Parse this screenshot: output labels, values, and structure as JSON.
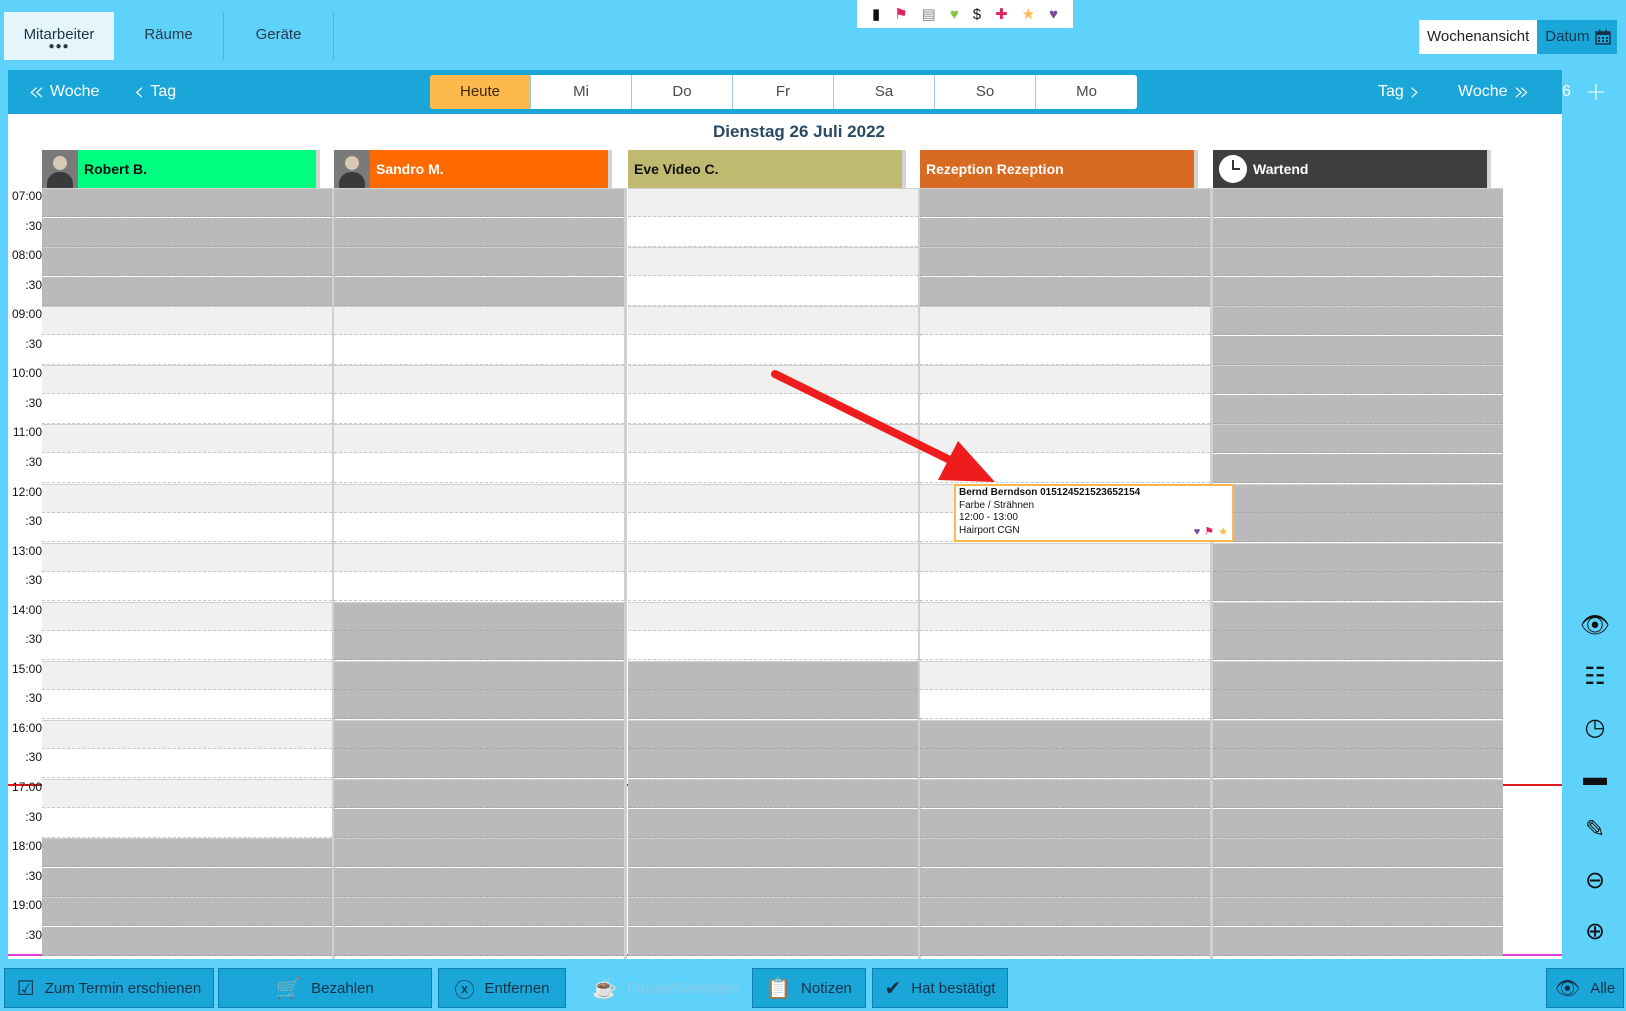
{
  "top_tabs": [
    {
      "label": "Mitarbeiter",
      "active": true
    },
    {
      "label": "Räume",
      "active": false
    },
    {
      "label": "Geräte",
      "active": false
    }
  ],
  "icon_strip": [
    {
      "icon": "phone-icon",
      "glyph": "▮",
      "color": "#111111"
    },
    {
      "icon": "flag-icon",
      "glyph": "⚑",
      "color": "#e0245e"
    },
    {
      "icon": "clipboard-icon",
      "glyph": "▤",
      "color": "#888888"
    },
    {
      "icon": "heart-icon",
      "glyph": "♥",
      "color": "#8ac43f"
    },
    {
      "icon": "dollar-icon",
      "glyph": "$",
      "color": "#111111"
    },
    {
      "icon": "plus-icon",
      "glyph": "✚",
      "color": "#e0245e"
    },
    {
      "icon": "star-icon",
      "glyph": "★",
      "color": "#fdb94c"
    },
    {
      "icon": "broken-heart-icon",
      "glyph": "♥",
      "color": "#7a4a9a"
    }
  ],
  "view_switch": {
    "week_view": "Wochenansicht",
    "date": "Datum"
  },
  "nav": {
    "prev_week": "Woche",
    "prev_day": "Tag",
    "next_day": "Tag",
    "next_week": "Woche",
    "count": "6",
    "days": [
      {
        "label": "Heute",
        "active": true
      },
      {
        "label": "Mi",
        "active": false
      },
      {
        "label": "Do",
        "active": false
      },
      {
        "label": "Fr",
        "active": false
      },
      {
        "label": "Sa",
        "active": false
      },
      {
        "label": "So",
        "active": false
      },
      {
        "label": "Mo",
        "active": false
      }
    ]
  },
  "date_heading": "Dienstag 26 Juli 2022",
  "staff": [
    {
      "name": "Robert B.",
      "color": "#00ff80",
      "avatar": "photo",
      "text_color": "#111111"
    },
    {
      "name": "Sandro M.",
      "color": "#ff6a00",
      "avatar": "photo",
      "text_color": "#ffffff"
    },
    {
      "name": "Eve Video C.",
      "color": "#bfba70",
      "avatar": "none",
      "text_color": "#111111"
    },
    {
      "name": "Rezeption Rezeption",
      "color": "#d86a22",
      "avatar": "none",
      "text_color": "#ffffff"
    },
    {
      "name": "Wartend",
      "color": "#3e3e3e",
      "avatar": "clock",
      "text_color": "#ffffff"
    }
  ],
  "time_labels": [
    "07:00",
    ":30",
    "08:00",
    ":30",
    "09:00",
    ":30",
    "10:00",
    ":30",
    "11:00",
    ":30",
    "12:00",
    ":30",
    "13:00",
    ":30",
    "14:00",
    ":30",
    "15:00",
    ":30",
    "16:00",
    ":30",
    "17:00",
    ":30",
    "18:00",
    ":30",
    "19:00",
    ":30"
  ],
  "availability": {
    "Robert B.": {
      "open_from": "09:00",
      "open_until": "18:00"
    },
    "Sandro M.": {
      "open_from": "09:00",
      "open_until": "14:00"
    },
    "Eve Video C.": {
      "open_from": "07:00",
      "open_until": "15:00"
    },
    "Rezeption Rezeption": {
      "open_from": "09:00",
      "open_until": "16:00"
    },
    "Wartend": {
      "open_from": null,
      "open_until": null
    }
  },
  "current_time": "17:05",
  "appointment": {
    "staff": "Rezeption Rezeption",
    "customer": "Bernd Berndson 015124521523652154",
    "service": "Farbe / Strähnen",
    "time": "12:00 - 13:00",
    "location": "Hairport CGN",
    "start": "12:00",
    "end": "13:00",
    "icons": [
      "broken-heart-icon",
      "flag-icon",
      "star-icon"
    ]
  },
  "side_tools": [
    {
      "name": "hide-icon",
      "glyph": "👁"
    },
    {
      "name": "group-icon",
      "glyph": "☷"
    },
    {
      "name": "clock-icon",
      "glyph": "◷"
    },
    {
      "name": "print-icon",
      "glyph": "▬"
    },
    {
      "name": "notes-edit-icon",
      "glyph": "✎"
    },
    {
      "name": "zoom-out-icon",
      "glyph": "⊖"
    },
    {
      "name": "zoom-in-icon",
      "glyph": "⊕"
    }
  ],
  "bottom_buttons": [
    {
      "name": "appeared-button",
      "label": "Zum Termin erschienen",
      "icon": "checkbox-icon",
      "glyph": "☑",
      "enabled": true
    },
    {
      "name": "pay-button",
      "label": "Bezahlen",
      "icon": "cart-icon",
      "glyph": "🛒",
      "enabled": true
    },
    {
      "name": "remove-button",
      "label": "Entfernen",
      "icon": "x-circle-icon",
      "glyph": "ⓧ",
      "enabled": true
    },
    {
      "name": "pause-button",
      "label": "Pause/Sonstiges",
      "icon": "coffee-icon",
      "glyph": "☕",
      "enabled": false
    },
    {
      "name": "notes-button",
      "label": "Notizen",
      "icon": "clipboard-icon",
      "glyph": "📋",
      "enabled": true
    },
    {
      "name": "confirmed-button",
      "label": "Hat bestätigt",
      "icon": "check-circle-icon",
      "glyph": "✔",
      "enabled": true
    },
    {
      "name": "all-button",
      "label": "Alle",
      "icon": "eye-icon",
      "glyph": "👁",
      "enabled": true
    }
  ]
}
